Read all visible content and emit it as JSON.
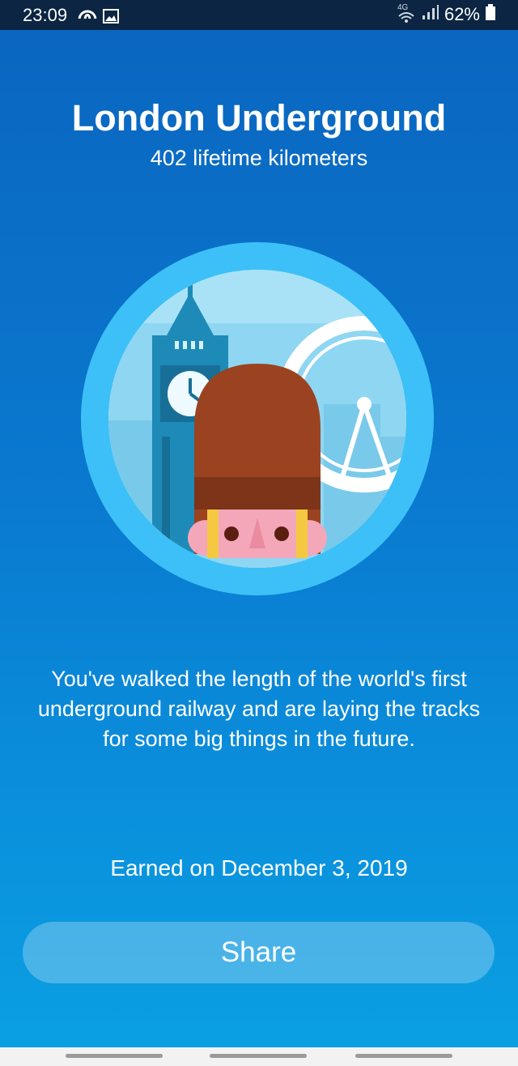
{
  "status_bar": {
    "time": "23:09",
    "network": "4G",
    "battery": "62%",
    "icons": [
      "cloud-icon",
      "image-icon",
      "wifi-icon",
      "signal-icon",
      "battery-icon"
    ]
  },
  "achievement": {
    "title": "London Underground",
    "subtitle": "402 lifetime kilometers",
    "badge_icon": "london-guard-badge-icon",
    "description": "You've walked the length of the world's first underground railway and are laying the tracks for some big things in the future.",
    "earned": "Earned on December 3, 2019"
  },
  "actions": {
    "share_label": "Share"
  },
  "colors": {
    "background_top": "#0a66c0",
    "background_bottom": "#0a9fe2",
    "badge_ring": "#3cc0f7",
    "hat": "#9b4320"
  }
}
